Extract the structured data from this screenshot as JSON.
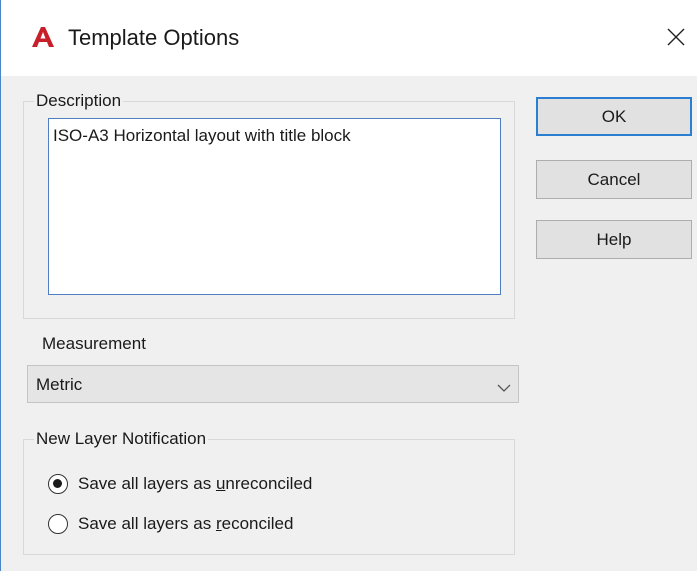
{
  "window": {
    "title": "Template Options",
    "app_icon": "autocad-a-icon",
    "close_icon": "close-icon",
    "accent": "#2c7fd0",
    "brand_color": "#c8202a"
  },
  "description": {
    "label": "Description",
    "text": "ISO-A3 Horizontal layout with title block"
  },
  "buttons": {
    "ok": "OK",
    "cancel": "Cancel",
    "help": "Help"
  },
  "measurement": {
    "label": "Measurement",
    "selected": "Metric",
    "chevron_icon": "chevron-down-icon"
  },
  "layer_notification": {
    "label": "New Layer Notification",
    "options": [
      {
        "pre": "Save all layers as ",
        "mnemonic": "u",
        "post": "nreconciled",
        "checked": true
      },
      {
        "pre": "Save all layers as ",
        "mnemonic": "r",
        "post": "econciled",
        "checked": false
      }
    ]
  }
}
